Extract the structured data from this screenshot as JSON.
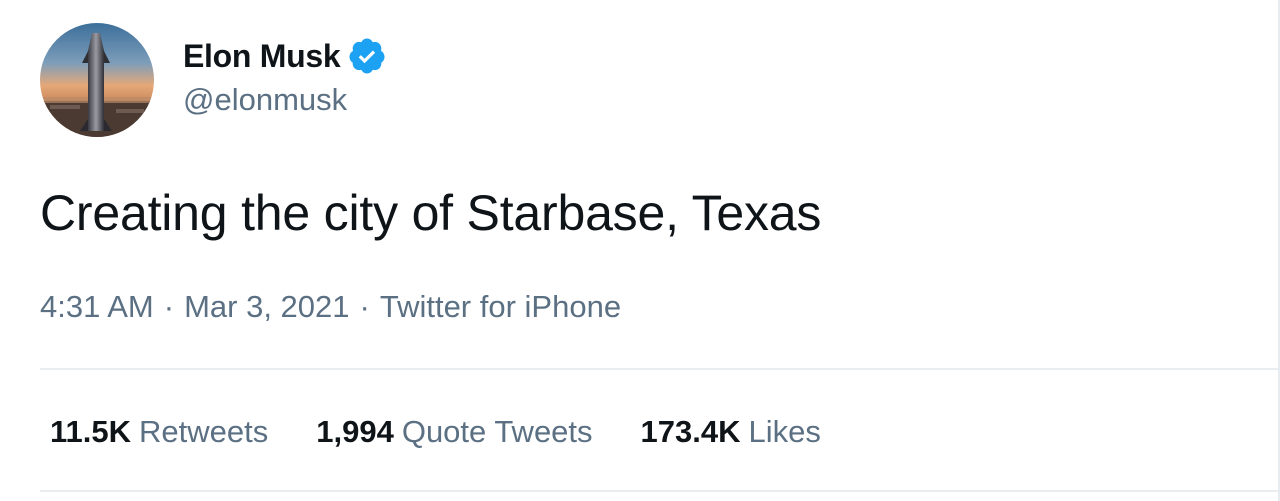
{
  "author": {
    "display_name": "Elon Musk",
    "handle": "@elonmusk",
    "verified": true,
    "verified_icon": "verified-badge-icon",
    "verified_color": "#1da1f2",
    "avatar_icon": "starship-avatar-icon"
  },
  "tweet": {
    "text": "Creating the city of Starbase, Texas"
  },
  "meta": {
    "time": "4:31 AM",
    "separator": "·",
    "date": "Mar 3, 2021",
    "source": "Twitter for iPhone"
  },
  "stats": {
    "retweets": {
      "count": "11.5K",
      "label": "Retweets"
    },
    "quote_tweets": {
      "count": "1,994",
      "label": "Quote Tweets"
    },
    "likes": {
      "count": "173.4K",
      "label": "Likes"
    }
  },
  "colors": {
    "text_primary": "#0f1419",
    "text_secondary": "#5b7083",
    "divider": "#ebeef0"
  }
}
